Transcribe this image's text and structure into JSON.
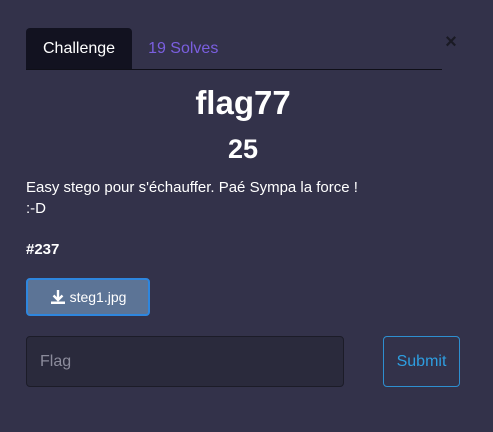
{
  "tabs": [
    {
      "label": "Challenge",
      "active": true
    },
    {
      "label": "19 Solves",
      "active": false
    }
  ],
  "close_label": "×",
  "challenge": {
    "name": "flag77",
    "points": "25",
    "description_line1": "Easy stego pour s'échauffer. Paé Sympa la force !",
    "description_line2": ":-D",
    "id": "#237"
  },
  "file": {
    "icon": "download-icon",
    "label": "steg1.jpg"
  },
  "form": {
    "flag_placeholder": "Flag",
    "flag_value": "",
    "submit_label": "Submit"
  },
  "colors": {
    "background": "#33324a",
    "active_tab": "#121220",
    "solves_tab_text": "#7b5fe0",
    "file_button": "#5c7496",
    "submit_accent": "#2e9ee0"
  }
}
